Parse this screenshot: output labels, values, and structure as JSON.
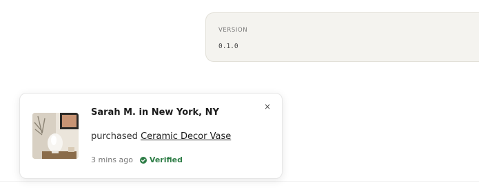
{
  "version_panel": {
    "label": "VERSION",
    "value": "0.1.0"
  },
  "purchase_notification": {
    "buyer": "Sarah M. in New York, NY",
    "action_text": "purchased",
    "product_name": "Ceramic Decor Vase",
    "time_ago": "3 mins ago",
    "verified_label": "Verified",
    "close_icon": "×",
    "image_icon": "ceramic-vase-photo",
    "verified_color": "#2e7d46"
  }
}
